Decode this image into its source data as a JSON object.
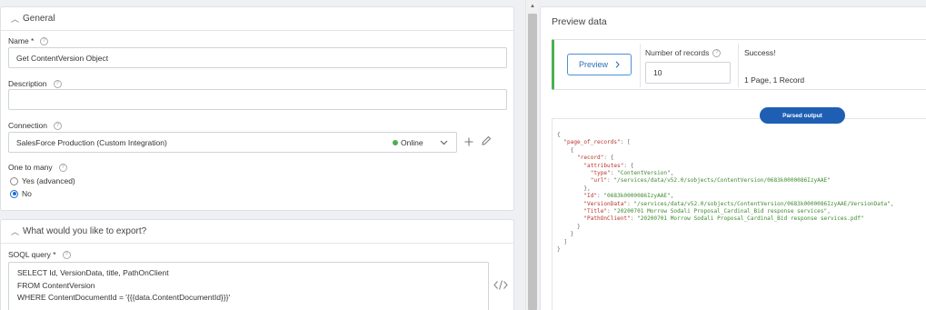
{
  "general": {
    "header": "General",
    "name_label": "Name *",
    "name_value": "Get ContentVersion Object",
    "description_label": "Description",
    "description_value": "",
    "connection_label": "Connection",
    "connection_value": "SalesForce Production (Custom Integration)",
    "connection_status": "Online",
    "one_to_many_label": "One to many",
    "option_yes": "Yes (advanced)",
    "option_no": "No",
    "selected_option": "No"
  },
  "export": {
    "header": "What would you like to export?",
    "soql_label": "SOQL query *",
    "soql_lines": [
      "SELECT Id, VersionData, title, PathOnClient",
      "FROM ContentVersion",
      "WHERE ContentDocumentId = '{{{data.ContentDocumentId}}}'"
    ]
  },
  "preview": {
    "title": "Preview data",
    "button_label": "Preview",
    "records_label": "Number of records",
    "records_value": "10",
    "status": "Success!",
    "pages": "1 Page, 1 Record",
    "parsed_label": "Parsed output"
  },
  "json_output": {
    "page_key": "\"page_of_records\"",
    "record_key": "\"record\"",
    "attributes_key": "\"attributes\"",
    "type_key": "\"type\"",
    "type_val": "\"ContentVersion\"",
    "url_key": "\"url\"",
    "url_val": "\"/services/data/v52.0/sobjects/ContentVersion/0683k0000086IzyAAE\"",
    "id_key": "\"Id\"",
    "id_val": "\"0683k0000086IzyAAE\"",
    "versiondata_key": "\"VersionData\"",
    "versiondata_val": "\"/services/data/v52.0/sobjects/ContentVersion/0683k0000086IzyAAE/VersionData\"",
    "title_key": "\"Title\"",
    "title_val": "\"20200701 Morrow Sodali Proposal_Cardinal_Bid response services\"",
    "path_key": "\"PathOnClient\"",
    "path_val": "\"20200701 Morrow Sodali Proposal_Cardinal_Bid response services.pdf\""
  },
  "colors": {
    "accent": "#1e5fb3",
    "success": "#4caf50",
    "json_key": "#b5342c",
    "json_string": "#3d8a2e"
  },
  "icons": [
    "chevron-up-icon",
    "help-icon",
    "chevron-down-icon",
    "plus-icon",
    "pencil-icon",
    "code-icon",
    "chevron-right-icon"
  ]
}
